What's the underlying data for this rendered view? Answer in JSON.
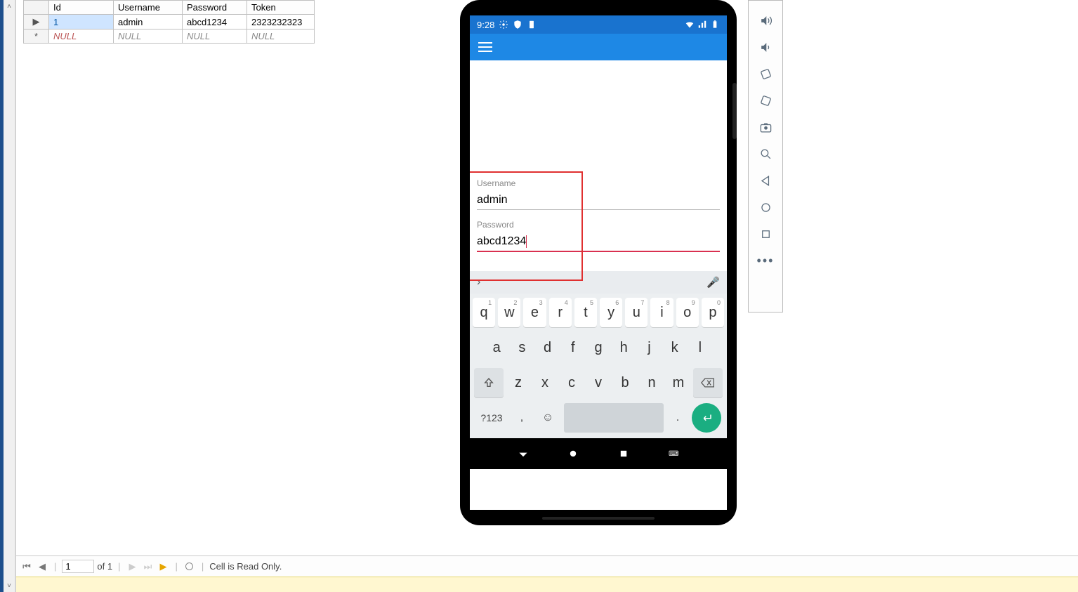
{
  "grid": {
    "headers": {
      "id": "Id",
      "username": "Username",
      "password": "Password",
      "token": "Token"
    },
    "rows": [
      {
        "marker": "▶",
        "id": "1",
        "username": "admin",
        "password": "abcd1234",
        "token": "2323232323",
        "selected": true
      },
      {
        "marker": "*",
        "id": "NULL",
        "username": "NULL",
        "password": "NULL",
        "token": "NULL",
        "null_row": true
      }
    ]
  },
  "phone": {
    "status_time": "9:28",
    "form": {
      "username_label": "Username",
      "username_value": "admin",
      "password_label": "Password",
      "password_value": "abcd1234"
    },
    "keyboard": {
      "row1": [
        "q",
        "w",
        "e",
        "r",
        "t",
        "y",
        "u",
        "i",
        "o",
        "p"
      ],
      "row1_sup": [
        "1",
        "2",
        "3",
        "4",
        "5",
        "6",
        "7",
        "8",
        "9",
        "0"
      ],
      "row2": [
        "a",
        "s",
        "d",
        "f",
        "g",
        "h",
        "j",
        "k",
        "l"
      ],
      "row3": [
        "z",
        "x",
        "c",
        "v",
        "b",
        "n",
        "m"
      ],
      "numkey": "?123",
      "comma": ",",
      "dot": "."
    }
  },
  "ide_nav": {
    "current": "1",
    "of": "of 1",
    "status": "Cell is Read Only."
  },
  "emu_tools": {
    "vol_up": "volume-up",
    "vol_down": "volume-down",
    "rotate_l": "rotate-left",
    "rotate_r": "rotate-right",
    "camera": "camera",
    "zoom": "zoom",
    "back": "back",
    "home": "home",
    "recent": "recent",
    "more": "more"
  }
}
